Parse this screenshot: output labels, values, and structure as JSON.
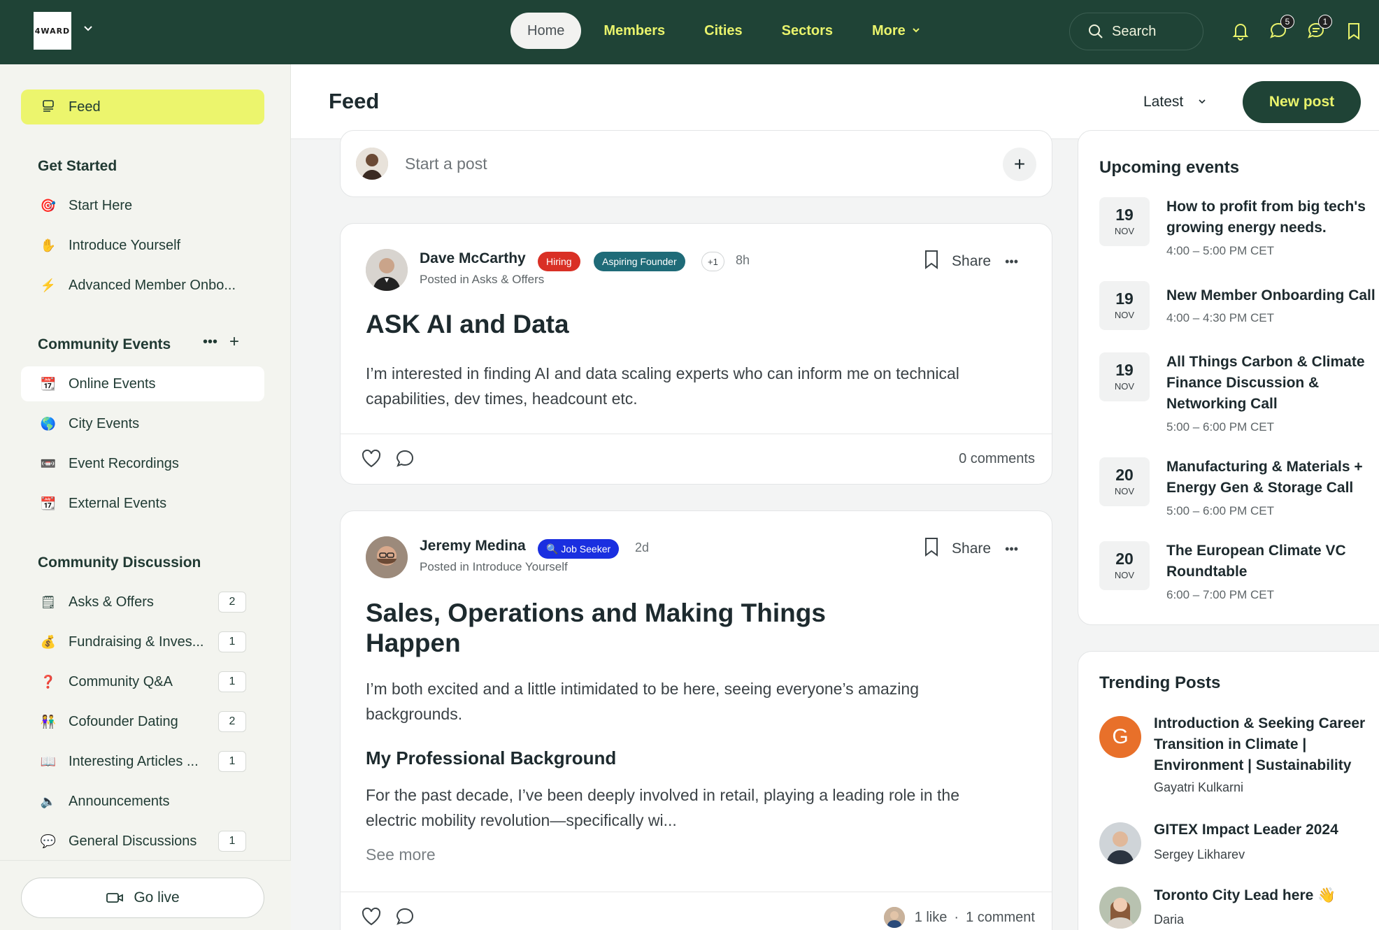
{
  "app": {
    "logo_text": "4WARD"
  },
  "topnav": {
    "items": [
      "Home",
      "Members",
      "Cities",
      "Sectors",
      "More"
    ],
    "search_placeholder": "Search",
    "messages_badge": "5",
    "chat_badge": "1"
  },
  "sidebar": {
    "feed": "Feed",
    "get_started_heading": "Get Started",
    "get_started": [
      {
        "emoji": "🎯",
        "label": "Start Here"
      },
      {
        "emoji": "✋",
        "label": "Introduce Yourself"
      },
      {
        "emoji": "⚡",
        "label": "Advanced Member Onbo..."
      }
    ],
    "events_heading": "Community Events",
    "events": [
      {
        "emoji": "📆",
        "label": "Online Events"
      },
      {
        "emoji": "🌎",
        "label": "City Events"
      },
      {
        "emoji": "📼",
        "label": "Event Recordings"
      },
      {
        "emoji": "📆",
        "label": "External Events"
      }
    ],
    "discussion_heading": "Community Discussion",
    "discussion": [
      {
        "emoji": "🗒",
        "label": "Asks & Offers",
        "count": "2"
      },
      {
        "emoji": "💰",
        "label": "Fundraising & Inves...",
        "count": "1"
      },
      {
        "emoji": "❓",
        "label": "Community Q&A",
        "count": "1"
      },
      {
        "emoji": "👫",
        "label": "Cofounder Dating",
        "count": "2"
      },
      {
        "emoji": "📖",
        "label": "Interesting Articles ...",
        "count": "1"
      },
      {
        "emoji": "🔈",
        "label": "Announcements",
        "count": ""
      },
      {
        "emoji": "💬",
        "label": "General Discussions",
        "count": "1"
      }
    ],
    "go_live": "Go live"
  },
  "feed": {
    "title": "Feed",
    "sort": "Latest",
    "new_post": "New post",
    "composer_placeholder": "Start a post",
    "posts": [
      {
        "author": "Dave McCarthy",
        "badges": [
          "Hiring",
          "Aspiring Founder",
          "+1"
        ],
        "time": "8h",
        "posted_in": "Posted in Asks & Offers",
        "title": "ASK AI and Data",
        "body": "I’m interested in finding AI and data scaling experts who can inform me on technical capabilities, dev times, headcount etc.",
        "share": "Share",
        "comments": "0 comments"
      },
      {
        "author": "Jeremy Medina",
        "badges": [
          "🔍 Job Seeker"
        ],
        "time": "2d",
        "posted_in": "Posted in Introduce Yourself",
        "title_line1": "Sales, Operations and Making Things",
        "title_line2": "Happen",
        "body": "I’m both excited and a little intimidated to be here, seeing everyone’s amazing backgrounds.",
        "subheading": "My Professional Background",
        "body2": "For the past decade, I’ve been deeply involved in retail, playing a leading role in the electric mobility revolution—specifically wi...",
        "see_more": "See more",
        "share": "Share",
        "likes": "1 like",
        "separator": "·",
        "comments": "1 comment"
      }
    ]
  },
  "upcoming": {
    "title": "Upcoming events",
    "events": [
      {
        "day": "19",
        "month": "NOV",
        "title": "How to profit from big tech's growing energy needs.",
        "time": "4:00 – 5:00 PM CET"
      },
      {
        "day": "19",
        "month": "NOV",
        "title": "New Member Onboarding Call",
        "time": "4:00 – 4:30 PM CET"
      },
      {
        "day": "19",
        "month": "NOV",
        "title": "All Things Carbon & Climate Finance Discussion & Networking Call",
        "time": "5:00 – 6:00 PM CET"
      },
      {
        "day": "20",
        "month": "NOV",
        "title": "Manufacturing & Materials + Energy Gen & Storage Call",
        "time": "5:00 – 6:00 PM CET"
      },
      {
        "day": "20",
        "month": "NOV",
        "title": "The European Climate VC Roundtable",
        "time": "6:00 – 7:00 PM CET"
      }
    ]
  },
  "trending": {
    "title": "Trending Posts",
    "posts": [
      {
        "avatar_letter": "G",
        "title": "Introduction & Seeking Career Transition in Climate | Environment | Sustainability",
        "author": "Gayatri Kulkarni"
      },
      {
        "title": "GITEX Impact Leader 2024",
        "author": "Sergey Likharev"
      },
      {
        "title": "Toronto City Lead here 👋",
        "author": "Daria"
      }
    ]
  },
  "colors": {
    "brand_dark": "#1f4336",
    "accent_yellow": "#e9f36c",
    "hiring_red": "#d93025",
    "founder_teal": "#1f6b78",
    "jobseeker_blue": "#1a2fe0",
    "trending_orange": "#e8702a"
  }
}
